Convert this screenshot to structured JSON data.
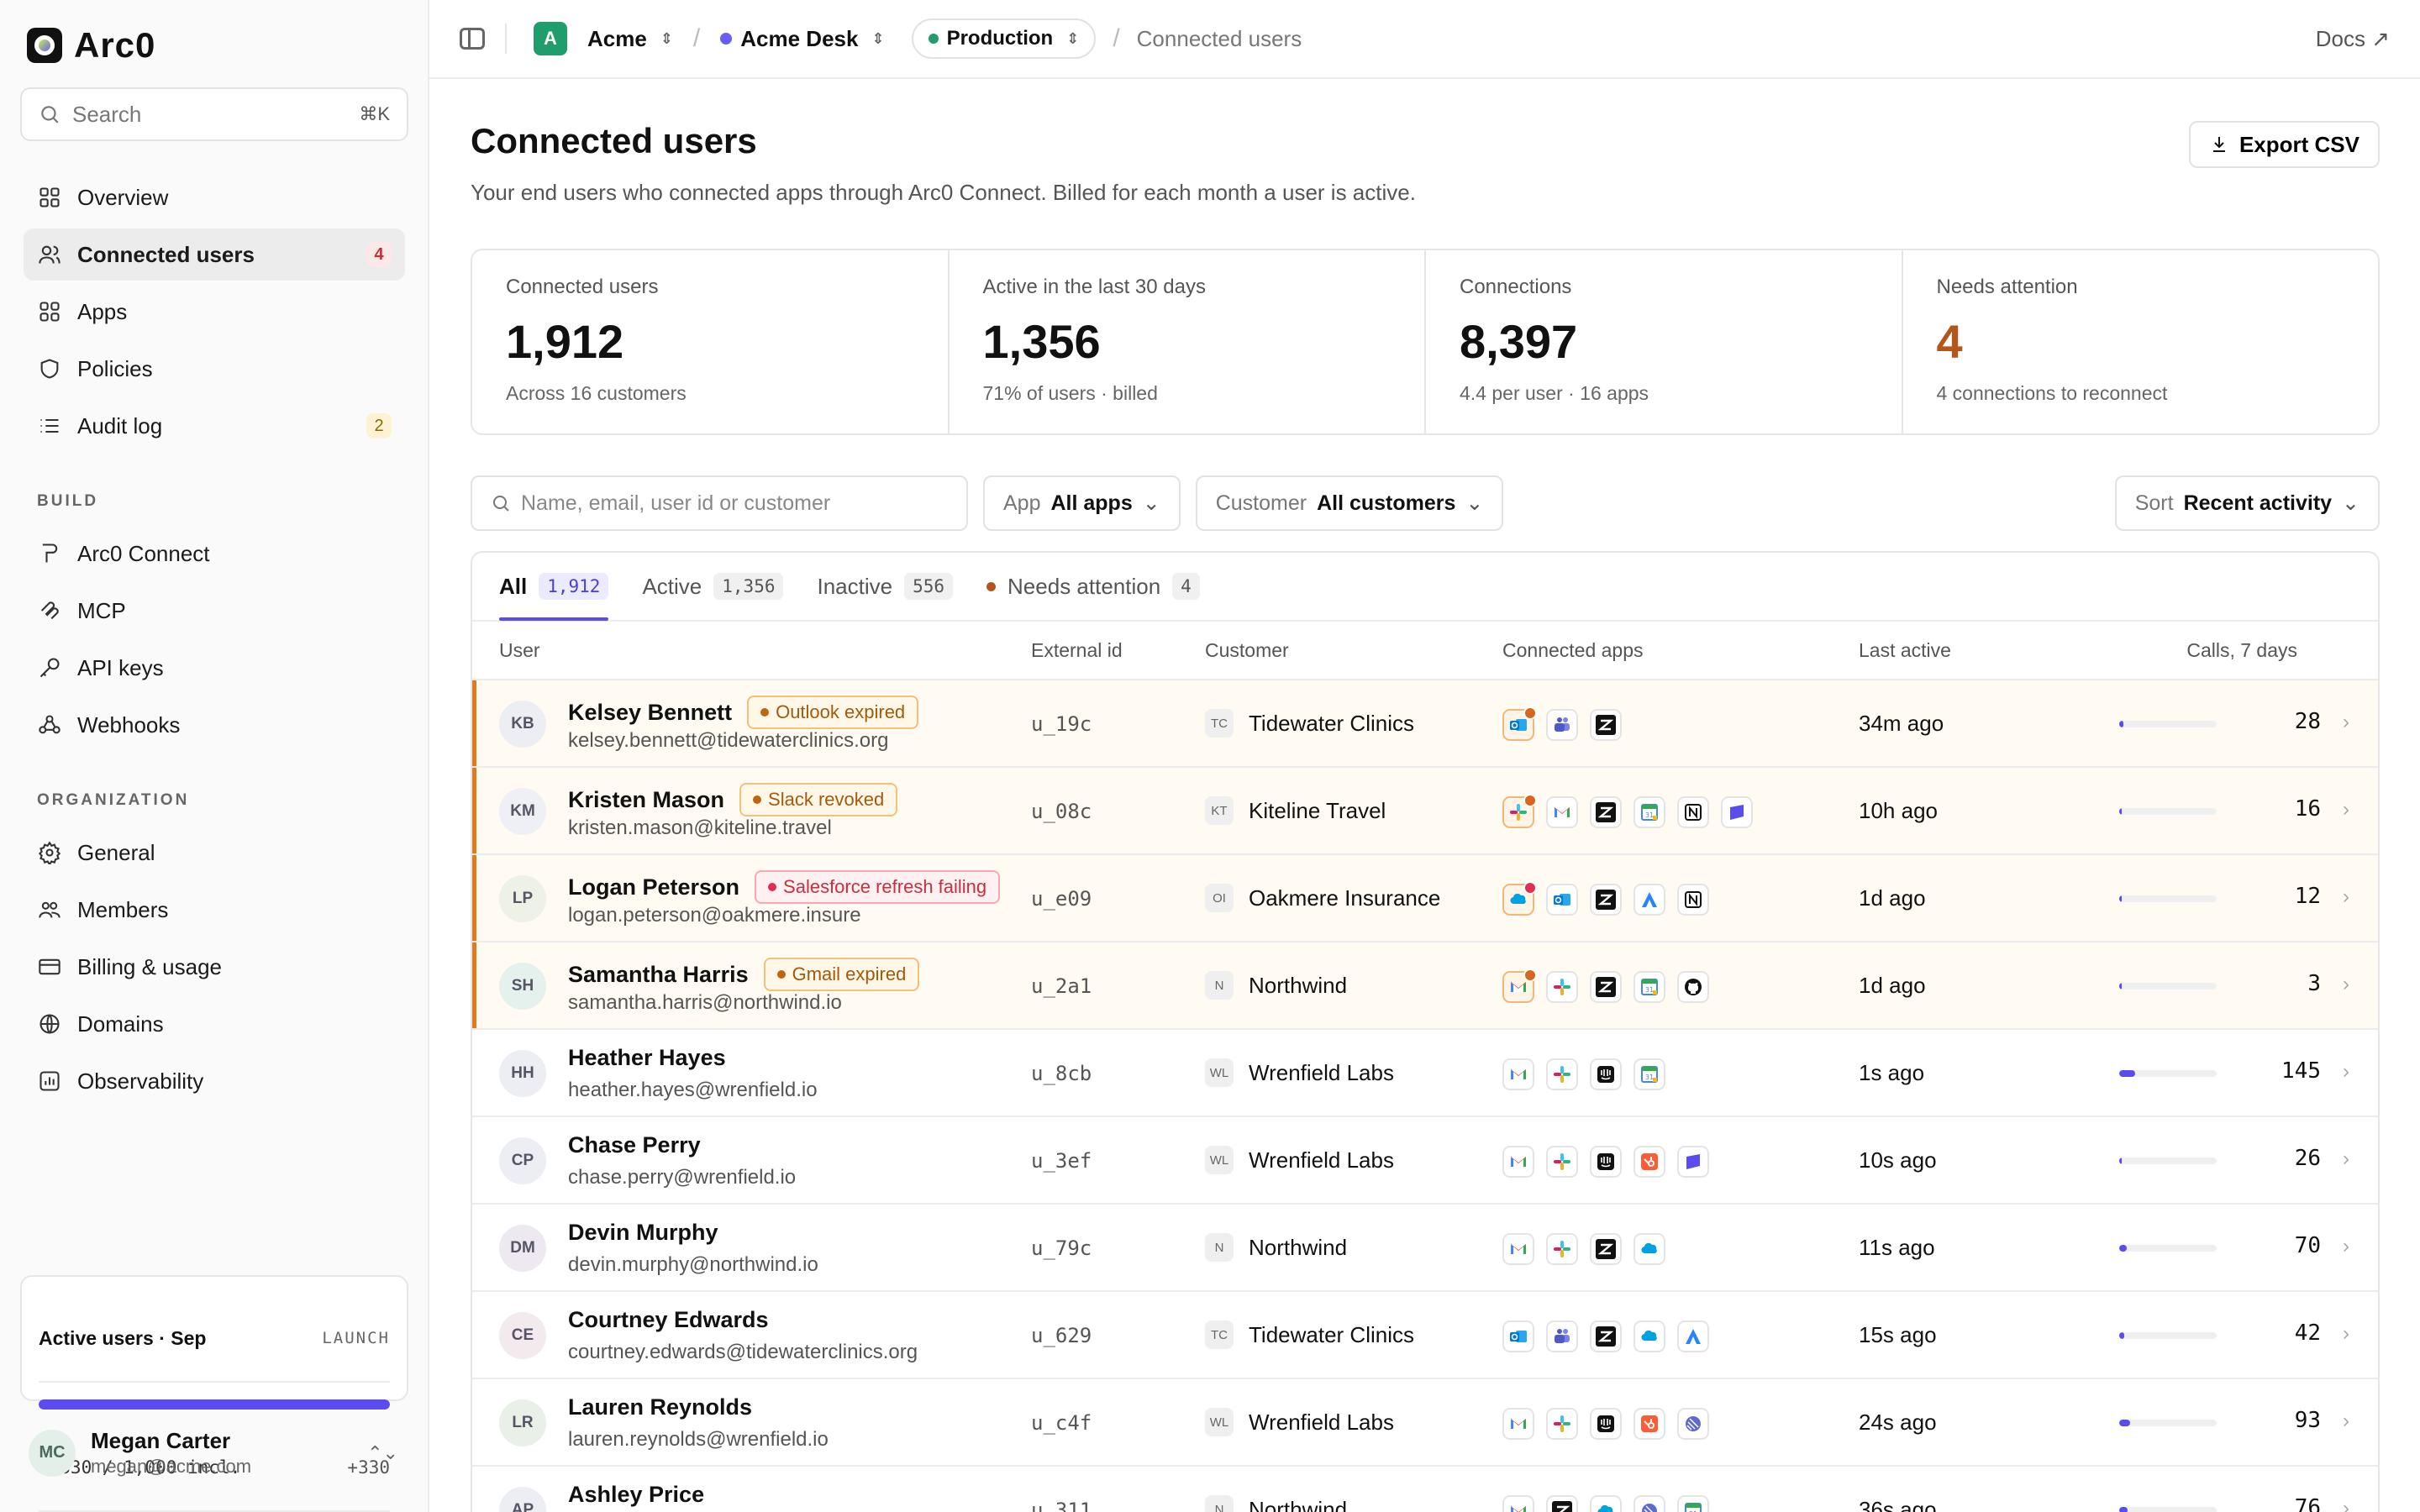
{
  "brand": {
    "name": "Arc0"
  },
  "search": {
    "placeholder": "Search",
    "shortcut": "⌘K"
  },
  "nav": {
    "main": [
      {
        "label": "Overview",
        "icon": "grid-icon"
      },
      {
        "label": "Connected users",
        "icon": "users-icon",
        "badge": "4",
        "active": true
      },
      {
        "label": "Apps",
        "icon": "apps-icon"
      },
      {
        "label": "Policies",
        "icon": "shield-icon"
      },
      {
        "label": "Audit log",
        "icon": "list-icon",
        "badge": "2"
      }
    ],
    "build_label": "BUILD",
    "build": [
      {
        "label": "Arc0 Connect",
        "icon": "plug-icon"
      },
      {
        "label": "MCP",
        "icon": "mcp-icon"
      },
      {
        "label": "API keys",
        "icon": "key-icon"
      },
      {
        "label": "Webhooks",
        "icon": "webhook-icon"
      }
    ],
    "org_label": "ORGANIZATION",
    "org": [
      {
        "label": "General",
        "icon": "gear-icon"
      },
      {
        "label": "Members",
        "icon": "members-icon"
      },
      {
        "label": "Billing & usage",
        "icon": "card-icon"
      },
      {
        "label": "Domains",
        "icon": "globe-icon"
      },
      {
        "label": "Observability",
        "icon": "chart-icon"
      }
    ]
  },
  "usage": {
    "title": "Active users · Sep",
    "tag": "LAUNCH",
    "used": "1,330 / 1,000 incl.",
    "over": "+330",
    "fill": 1.0
  },
  "profile": {
    "initials": "MC",
    "name": "Megan Carter",
    "email": "megan@acme.com"
  },
  "topbar": {
    "workspace_initial": "A",
    "workspace": "Acme",
    "project": "Acme Desk",
    "env": "Production",
    "current": "Connected users",
    "docs": "Docs ↗"
  },
  "page": {
    "title": "Connected users",
    "subtitle": "Your end users who connected apps through Arc0 Connect. Billed for each month a user is active.",
    "export": "Export CSV"
  },
  "stats": [
    {
      "label": "Connected users",
      "value": "1,912",
      "sub": "Across 16 customers"
    },
    {
      "label": "Active in the last 30 days",
      "value": "1,356",
      "sub": "71% of users · billed"
    },
    {
      "label": "Connections",
      "value": "8,397",
      "sub": "4.4 per user · 16 apps"
    },
    {
      "label": "Needs attention",
      "value": "4",
      "sub": "4 connections to reconnect"
    }
  ],
  "filters": {
    "search_placeholder": "Name, email, user id or customer",
    "app_label": "App",
    "app_value": "All apps",
    "customer_label": "Customer",
    "customer_value": "All customers",
    "sort_label": "Sort",
    "sort_value": "Recent activity"
  },
  "tabs": [
    {
      "label": "All",
      "count": "1,912",
      "active": true
    },
    {
      "label": "Active",
      "count": "1,356"
    },
    {
      "label": "Inactive",
      "count": "556"
    },
    {
      "label": "Needs attention",
      "count": "4",
      "dot": true
    }
  ],
  "columns": {
    "user": "User",
    "external": "External id",
    "customer": "Customer",
    "apps": "Connected apps",
    "last": "Last active",
    "calls": "Calls, 7 days"
  },
  "rows": [
    {
      "initials": "KB",
      "name": "Kelsey Bennett",
      "email": "kelsey.bennett@tidewaterclinics.org",
      "pill": "Outlook expired",
      "pill_kind": "amber",
      "ext": "u_19c",
      "cust_ico": "TC",
      "customer": "Tidewater Clinics",
      "apps": [
        "outlook-icon:bad",
        "teams-icon",
        "zendesk-icon"
      ],
      "last": "34m ago",
      "calls": "28",
      "level": 0.04
    },
    {
      "initials": "KM",
      "name": "Kristen Mason",
      "email": "kristen.mason@kiteline.travel",
      "pill": "Slack revoked",
      "pill_kind": "amber",
      "ext": "u_08c",
      "cust_ico": "KT",
      "customer": "Kiteline Travel",
      "apps": [
        "slack-icon:bad",
        "gmail-icon",
        "zendesk-icon",
        "calendar-icon",
        "notion-icon",
        "linear-icon"
      ],
      "last": "10h ago",
      "calls": "16",
      "level": 0.03
    },
    {
      "initials": "LP",
      "name": "Logan Peterson",
      "email": "logan.peterson@oakmere.insure",
      "pill": "Salesforce refresh failing",
      "pill_kind": "red",
      "ext": "u_e09",
      "cust_ico": "OI",
      "customer": "Oakmere Insurance",
      "apps": [
        "salesforce-icon:badr",
        "outlook-icon",
        "zendesk-icon",
        "atlassian-icon",
        "notion-icon"
      ],
      "last": "1d ago",
      "calls": "12",
      "level": 0.02
    },
    {
      "initials": "SH",
      "name": "Samantha Harris",
      "email": "samantha.harris@northwind.io",
      "pill": "Gmail expired",
      "pill_kind": "amber",
      "ext": "u_2a1",
      "cust_ico": "N",
      "customer": "Northwind",
      "apps": [
        "gmail-icon:bad",
        "slack-icon",
        "zendesk-icon",
        "calendar-icon",
        "github-icon"
      ],
      "last": "1d ago",
      "calls": "3",
      "level": 0.01
    },
    {
      "initials": "HH",
      "name": "Heather Hayes",
      "email": "heather.hayes@wrenfield.io",
      "ext": "u_8cb",
      "cust_ico": "WL",
      "customer": "Wrenfield Labs",
      "apps": [
        "gmail-icon",
        "slack-icon",
        "intercom-icon",
        "calendar-icon"
      ],
      "last": "1s ago",
      "calls": "145",
      "level": 0.16
    },
    {
      "initials": "CP",
      "name": "Chase Perry",
      "email": "chase.perry@wrenfield.io",
      "ext": "u_3ef",
      "cust_ico": "WL",
      "customer": "Wrenfield Labs",
      "apps": [
        "gmail-icon",
        "slack-icon",
        "intercom-icon",
        "hubspot-icon",
        "linear-icon"
      ],
      "last": "10s ago",
      "calls": "26",
      "level": 0.03
    },
    {
      "initials": "DM",
      "name": "Devin Murphy",
      "email": "devin.murphy@northwind.io",
      "ext": "u_79c",
      "cust_ico": "N",
      "customer": "Northwind",
      "apps": [
        "gmail-icon",
        "slack-icon",
        "zendesk-icon",
        "salesforce-icon"
      ],
      "last": "11s ago",
      "calls": "70",
      "level": 0.08
    },
    {
      "initials": "CE",
      "name": "Courtney Edwards",
      "email": "courtney.edwards@tidewaterclinics.org",
      "ext": "u_629",
      "cust_ico": "TC",
      "customer": "Tidewater Clinics",
      "apps": [
        "outlook-icon",
        "teams-icon",
        "zendesk-icon",
        "salesforce-icon",
        "atlassian-icon"
      ],
      "last": "15s ago",
      "calls": "42",
      "level": 0.05
    },
    {
      "initials": "LR",
      "name": "Lauren Reynolds",
      "email": "lauren.reynolds@wrenfield.io",
      "ext": "u_c4f",
      "cust_ico": "WL",
      "customer": "Wrenfield Labs",
      "apps": [
        "gmail-icon",
        "slack-icon",
        "intercom-icon",
        "hubspot-icon",
        "linear2-icon"
      ],
      "last": "24s ago",
      "calls": "93",
      "level": 0.11
    },
    {
      "initials": "AP",
      "name": "Ashley Price",
      "email": "",
      "ext": "u_311",
      "cust_ico": "N",
      "customer": "Northwind",
      "apps": [
        "gmail-icon",
        "zendesk-icon",
        "salesforce-icon",
        "linear2-icon",
        "calendar-icon"
      ],
      "last": "36s ago",
      "calls": "76",
      "level": 0.09
    }
  ],
  "colors": {
    "accent": "#5b4cf0",
    "warning": "#b4561a",
    "danger": "#e12f52"
  }
}
